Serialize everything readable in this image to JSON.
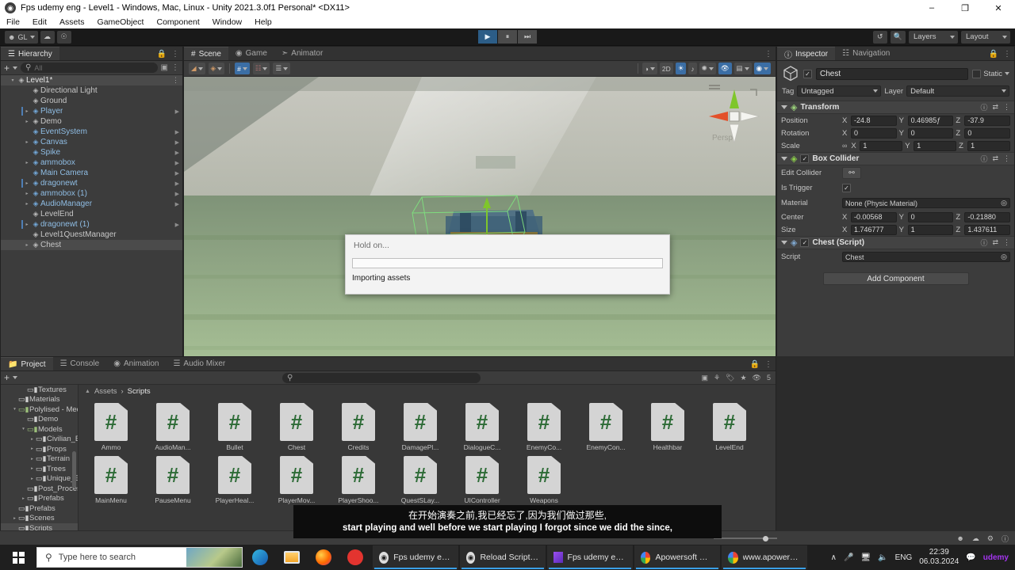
{
  "window": {
    "title": "Fps udemy eng - Level1 - Windows, Mac, Linux - Unity 2021.3.0f1 Personal* <DX11>",
    "app_icon": "unity-icon",
    "minimize": "–",
    "maximize": "❐",
    "close": "✕"
  },
  "menu": {
    "items": [
      "File",
      "Edit",
      "Assets",
      "GameObject",
      "Component",
      "Window",
      "Help"
    ]
  },
  "toolbar": {
    "account_label": "GL",
    "cloud_icon": "cloud-icon",
    "collab_icon": "collab-icon",
    "play_icon": "▶",
    "pause_icon": "⏸",
    "step_icon": "⏭",
    "history_icon": "history-icon",
    "search_icon": "search-icon",
    "layers_label": "Layers",
    "layout_label": "Layout"
  },
  "hierarchy": {
    "tab": "Hierarchy",
    "lock_icon": "lock-icon",
    "menu_icon": "kebab-icon",
    "add_label": "+",
    "search_placeholder": "All",
    "items": [
      {
        "label": "Level1*",
        "depth": 0,
        "twisty": "▾",
        "icon": "scene-icon",
        "scene": true,
        "prefab": false,
        "chevron": false,
        "dots": true
      },
      {
        "label": "Directional Light",
        "depth": 1,
        "twisty": "",
        "icon": "gameobject-icon",
        "prefab": false,
        "chevron": false
      },
      {
        "label": "Ground",
        "depth": 1,
        "twisty": "",
        "icon": "gameobject-icon",
        "prefab": false,
        "chevron": false
      },
      {
        "label": "Player",
        "depth": 1,
        "twisty": "▸",
        "icon": "prefab-icon",
        "prefab": true,
        "chevron": true,
        "marker": true
      },
      {
        "label": "Demo",
        "depth": 1,
        "twisty": "▸",
        "icon": "gameobject-icon",
        "prefab": false,
        "chevron": false
      },
      {
        "label": "EventSystem",
        "depth": 1,
        "twisty": "",
        "icon": "prefab-icon",
        "prefab": true,
        "chevron": true
      },
      {
        "label": "Canvas",
        "depth": 1,
        "twisty": "▸",
        "icon": "prefab-icon",
        "prefab": true,
        "chevron": true
      },
      {
        "label": "Spike",
        "depth": 1,
        "twisty": "",
        "icon": "prefab-icon",
        "prefab": true,
        "chevron": true
      },
      {
        "label": "ammobox",
        "depth": 1,
        "twisty": "▸",
        "icon": "prefab-icon",
        "prefab": true,
        "chevron": true
      },
      {
        "label": "Main Camera",
        "depth": 1,
        "twisty": "",
        "icon": "prefab-icon",
        "prefab": true,
        "chevron": true
      },
      {
        "label": "dragonewt",
        "depth": 1,
        "twisty": "▸",
        "icon": "prefab-icon",
        "prefab": true,
        "chevron": true,
        "marker": true
      },
      {
        "label": "ammobox (1)",
        "depth": 1,
        "twisty": "▸",
        "icon": "prefab-icon",
        "prefab": true,
        "chevron": true
      },
      {
        "label": "AudioManager",
        "depth": 1,
        "twisty": "▸",
        "icon": "prefab-icon",
        "prefab": true,
        "chevron": true
      },
      {
        "label": "LevelEnd",
        "depth": 1,
        "twisty": "",
        "icon": "gameobject-icon",
        "prefab": false,
        "chevron": false
      },
      {
        "label": "dragonewt (1)",
        "depth": 1,
        "twisty": "▸",
        "icon": "prefab-icon",
        "prefab": true,
        "chevron": true,
        "marker": true
      },
      {
        "label": "Level1QuestManager",
        "depth": 1,
        "twisty": "",
        "icon": "gameobject-icon",
        "prefab": false,
        "chevron": false
      },
      {
        "label": "Chest",
        "depth": 1,
        "twisty": "▸",
        "icon": "gameobject-icon",
        "prefab": false,
        "chevron": false,
        "selected": true
      }
    ]
  },
  "scene": {
    "tabs": [
      {
        "label": "Scene",
        "icon": "scene-grid-icon",
        "active": true
      },
      {
        "label": "Game",
        "icon": "game-display-icon",
        "active": false
      },
      {
        "label": "Animator",
        "icon": "animator-icon",
        "active": false
      }
    ],
    "menu_icon": "kebab-icon",
    "toolbar_left": [
      {
        "name": "shading-mode",
        "glyph": "◧",
        "on": false
      },
      {
        "name": "draw-mode-2d3d",
        "glyph": "⬢",
        "on": false
      },
      {
        "name": "scene-lighting-grid",
        "glyph": "#",
        "on": true
      },
      {
        "name": "scene-audio",
        "glyph": "⚙",
        "on": false
      },
      {
        "name": "scene-fx",
        "glyph": "☲",
        "on": false
      }
    ],
    "toolbar_right": [
      {
        "name": "scene-visibility",
        "glyph": "◑",
        "on": false
      },
      {
        "name": "toggle-2d",
        "glyph": "2D",
        "on": false
      },
      {
        "name": "scene-light-toggle",
        "glyph": "●",
        "on": true
      },
      {
        "name": "scene-audio-toggle",
        "glyph": "♪",
        "on": false
      },
      {
        "name": "scene-effects",
        "glyph": "✶",
        "on": false
      },
      {
        "name": "scene-hidden-objects",
        "glyph": "◎",
        "on": true
      },
      {
        "name": "scene-camera",
        "glyph": "▤",
        "on": false
      },
      {
        "name": "gizmos-toggle",
        "glyph": "⊕",
        "on": true
      }
    ],
    "gizmo_label": "Persp",
    "gizmo_axes": {
      "x_color": "#e3502a",
      "y_color": "#7fc62b",
      "z_color": "#3d7fd8"
    }
  },
  "inspector": {
    "tabs": [
      {
        "label": "Inspector",
        "icon": "info-icon",
        "active": true
      },
      {
        "label": "Navigation",
        "icon": "navigation-icon",
        "active": false
      }
    ],
    "lock_icon": "lock-icon",
    "menu_icon": "kebab-icon",
    "object_name": "Chest",
    "enabled": true,
    "static_label": "Static",
    "tag_label": "Tag",
    "tag_value": "Untagged",
    "layer_label": "Layer",
    "layer_value": "Default",
    "components": [
      {
        "name": "Transform",
        "icon": "transform-icon",
        "has_checkbox": false,
        "rows": [
          {
            "label": "Position",
            "fields": [
              {
                "axis": "X",
                "value": "-24.8"
              },
              {
                "axis": "Y",
                "value": "0.46985ƒ"
              },
              {
                "axis": "Z",
                "value": "-37.9"
              }
            ]
          },
          {
            "label": "Rotation",
            "fields": [
              {
                "axis": "X",
                "value": "0"
              },
              {
                "axis": "Y",
                "value": "0"
              },
              {
                "axis": "Z",
                "value": "0"
              }
            ]
          },
          {
            "label": "Scale",
            "link_icon": "chain-link-icon",
            "fields": [
              {
                "axis": "X",
                "value": "1"
              },
              {
                "axis": "Y",
                "value": "1"
              },
              {
                "axis": "Z",
                "value": "1"
              }
            ]
          }
        ]
      },
      {
        "name": "Box Collider",
        "icon": "box-collider-icon",
        "has_checkbox": true,
        "checked": true,
        "simple_rows": [
          {
            "label": "Edit Collider",
            "type": "button",
            "value": "edit-collider-icon"
          },
          {
            "label": "Is Trigger",
            "type": "checkbox",
            "value": true
          },
          {
            "label": "Material",
            "type": "object",
            "value": "None (Physic Material)"
          }
        ],
        "rows": [
          {
            "label": "Center",
            "fields": [
              {
                "axis": "X",
                "value": "-0.00568"
              },
              {
                "axis": "Y",
                "value": "0"
              },
              {
                "axis": "Z",
                "value": "-0.21880"
              }
            ]
          },
          {
            "label": "Size",
            "fields": [
              {
                "axis": "X",
                "value": "1.746777"
              },
              {
                "axis": "Y",
                "value": "1"
              },
              {
                "axis": "Z",
                "value": "1.437611"
              }
            ]
          }
        ]
      },
      {
        "name": "Chest (Script)",
        "icon": "script-icon",
        "has_checkbox": true,
        "checked": true,
        "simple_rows": [
          {
            "label": "Script",
            "type": "object",
            "value": "Chest"
          }
        ],
        "rows": []
      }
    ],
    "add_component_label": "Add Component"
  },
  "project": {
    "tabs": [
      {
        "label": "Project",
        "icon": "folder-icon",
        "active": true
      },
      {
        "label": "Console",
        "icon": "console-icon",
        "active": false
      },
      {
        "label": "Animation",
        "icon": "animation-icon",
        "active": false
      },
      {
        "label": "Audio Mixer",
        "icon": "audio-mixer-icon",
        "active": false
      }
    ],
    "lock_icon": "lock-icon",
    "add_label": "+",
    "search_placeholder": "",
    "right_icons": [
      "search-by-type-icon",
      "search-by-label-icon",
      "favorite-tag-icon",
      "favorite-star-icon",
      "hidden-packages-icon"
    ],
    "hidden_count": "5",
    "breadcrumb": [
      "Assets",
      "Scripts"
    ],
    "tree": [
      {
        "label": "Textures",
        "depth": 2,
        "twisty": "",
        "partial": true
      },
      {
        "label": "Materials",
        "depth": 1,
        "twisty": ""
      },
      {
        "label": "Polylised - Medieval Dese",
        "depth": 1,
        "twisty": "▾",
        "open": true
      },
      {
        "label": "Demo",
        "depth": 2,
        "twisty": ""
      },
      {
        "label": "Models",
        "depth": 2,
        "twisty": "▾",
        "open": true
      },
      {
        "label": "Civilian_Buildings",
        "depth": 3,
        "twisty": "▸"
      },
      {
        "label": "Props",
        "depth": 3,
        "twisty": "▸"
      },
      {
        "label": "Terrain",
        "depth": 3,
        "twisty": "▸"
      },
      {
        "label": "Trees",
        "depth": 3,
        "twisty": "▸"
      },
      {
        "label": "Unique_Buildings",
        "depth": 3,
        "twisty": "▸"
      },
      {
        "label": "Post_Processing_Preset",
        "depth": 2,
        "twisty": ""
      },
      {
        "label": "Prefabs",
        "depth": 2,
        "twisty": "▸"
      },
      {
        "label": "Prefabs",
        "depth": 1,
        "twisty": ""
      },
      {
        "label": "Scenes",
        "depth": 1,
        "twisty": "▸"
      },
      {
        "label": "Scripts",
        "depth": 1,
        "twisty": "",
        "selected": true
      }
    ],
    "assets": [
      "Ammo",
      "AudioMan...",
      "Bullet",
      "Chest",
      "Credits",
      "DamagePl...",
      "DialogueC...",
      "EnemyCo...",
      "EnemyCon...",
      "Healthbar",
      "LevelEnd",
      "MainMenu",
      "PauseMenu",
      "PlayerHeal...",
      "PlayerMov...",
      "PlayerShoo...",
      "QuestSLay...",
      "UIController",
      "Weapons"
    ],
    "asset_icon": "csharp-script-icon"
  },
  "modal": {
    "title": "Hold on...",
    "progress_percent": 0,
    "status": "Importing assets"
  },
  "subtitles": {
    "line_cn": "在开始演奏之前,我已经忘了,因为我们做过那些,",
    "line_en": "start playing and well before we start playing I forgot since we did the since,"
  },
  "taskbar": {
    "start_icon": "windows-start-icon",
    "search_placeholder": "Type here to search",
    "search_icon": "search-icon",
    "pinned": [
      {
        "name": "edge-icon",
        "glyph": "e",
        "color": "#2a7fd4"
      },
      {
        "name": "file-explorer-icon",
        "glyph": "🗀",
        "color": "#ffc24b"
      },
      {
        "name": "firefox-icon",
        "glyph": "●",
        "color": "#ff7139"
      },
      {
        "name": "opera-icon",
        "glyph": "O",
        "color": "#e3342f"
      }
    ],
    "tasks": [
      {
        "label": "Fps udemy eng - ...",
        "icon": "unity-icon"
      },
      {
        "label": "Reload Script Asse...",
        "icon": "unity-icon"
      },
      {
        "label": "Fps udemy eng - ...",
        "icon": "visual-studio-icon"
      },
      {
        "label": "Apowersoft Onlin...",
        "icon": "chrome-icon"
      },
      {
        "label": "www.apowersoft....",
        "icon": "chrome-icon"
      }
    ],
    "tray": {
      "chevron": "∧",
      "mic_icon": "microphone-icon",
      "network_icon": "network-icon",
      "volume_icon": "speaker-icon",
      "language": "ENG",
      "time": "22:39",
      "date": "06.03.2024",
      "notifications_icon": "notifications-icon",
      "watermark": "udemy"
    }
  }
}
